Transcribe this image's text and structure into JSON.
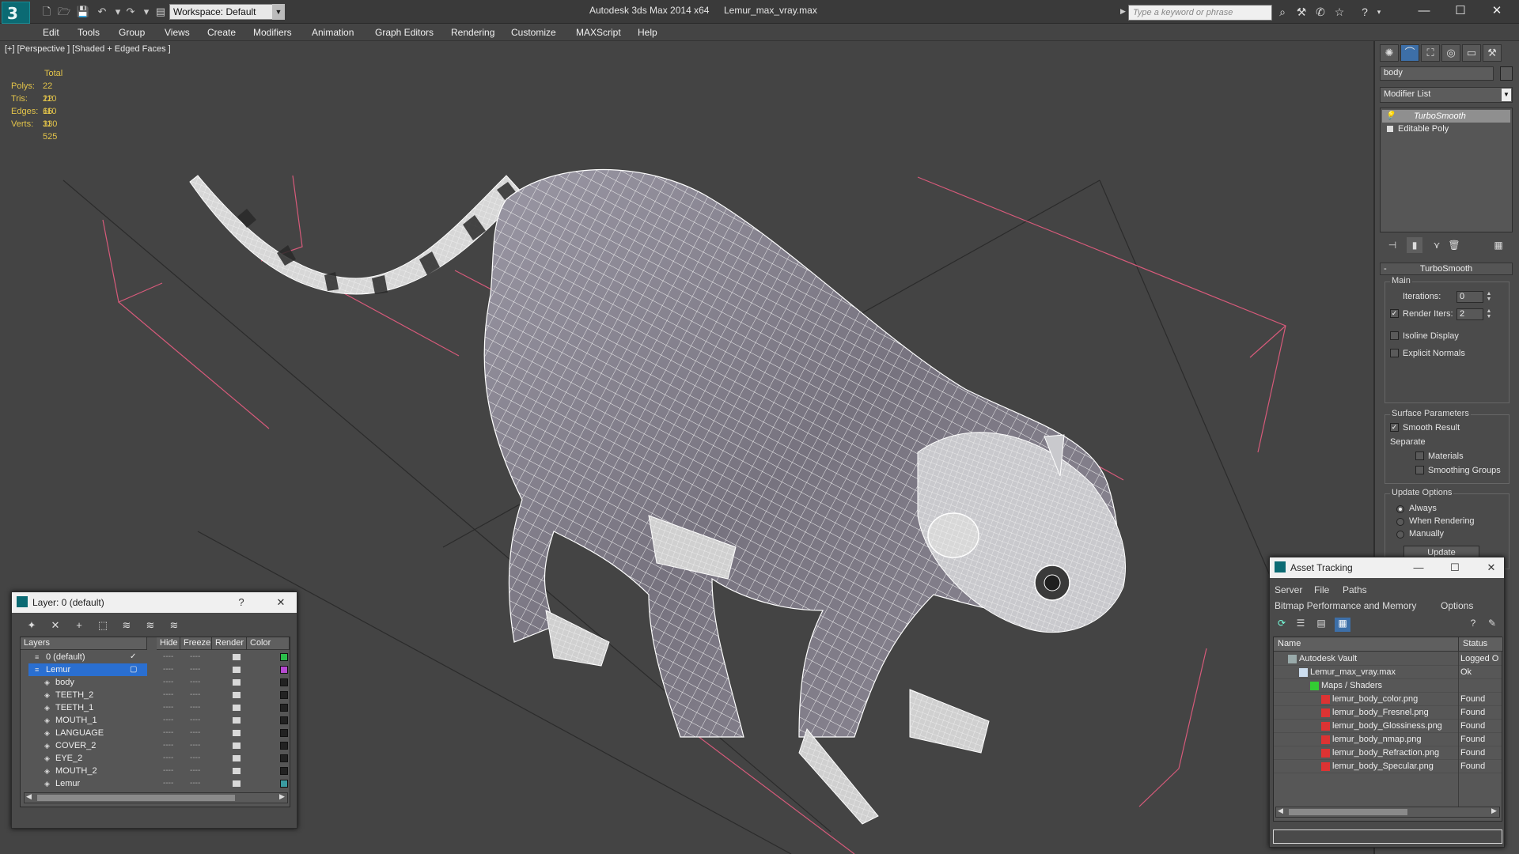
{
  "titlebar": {
    "logo": "3",
    "workspace": "Workspace: Default",
    "app_title": "Autodesk 3ds Max 2014 x64",
    "file_title": "Lemur_max_vray.max",
    "search_placeholder": "Type a keyword or phrase",
    "window_buttons": [
      "—",
      "☐",
      "✕"
    ]
  },
  "menu": [
    "Edit",
    "Tools",
    "Group",
    "Views",
    "Create",
    "Modifiers",
    "Animation",
    "Graph Editors",
    "Rendering",
    "Customize",
    "MAXScript",
    "Help"
  ],
  "viewport": {
    "label": "[+] [Perspective ] [Shaded + Edged Faces ]",
    "stats_header": "Total",
    "stats": [
      {
        "key": "Polys:",
        "value": "22 110"
      },
      {
        "key": "Tris:",
        "value": "22 110"
      },
      {
        "key": "Edges:",
        "value": "66 330"
      },
      {
        "key": "Verts:",
        "value": "11 525"
      }
    ]
  },
  "command_panel": {
    "object_name": "body",
    "modifier_list": "Modifier List",
    "stack": [
      {
        "label": "TurboSmooth",
        "selected": true
      },
      {
        "label": "Editable Poly",
        "selected": false
      }
    ],
    "rollout_title": "TurboSmooth",
    "main_group": "Main",
    "iterations_label": "Iterations:",
    "iterations_value": "0",
    "render_iters_label": "Render Iters:",
    "render_iters_value": "2",
    "render_iters_checked": true,
    "isoline_label": "Isoline Display",
    "explicit_normals_label": "Explicit Normals",
    "surface_group": "Surface Parameters",
    "smooth_result_label": "Smooth Result",
    "separate_label": "Separate",
    "materials_label": "Materials",
    "smoothing_groups_label": "Smoothing Groups",
    "update_group": "Update Options",
    "always_label": "Always",
    "when_rendering_label": "When Rendering",
    "manually_label": "Manually",
    "update_button": "Update"
  },
  "layer_dialog": {
    "title": "Layer: 0 (default)",
    "help": "?",
    "close": "✕",
    "columns": [
      "Layers",
      "Hide",
      "Freeze",
      "Render",
      "Color"
    ],
    "rows": [
      {
        "name": "0 (default)",
        "indent": 1,
        "color": "#2bbd4a",
        "active": true
      },
      {
        "name": "Lemur",
        "indent": 1,
        "color": "#b64ad0",
        "selected": true
      },
      {
        "name": "body",
        "indent": 2,
        "color": "#222222"
      },
      {
        "name": "TEETH_2",
        "indent": 2,
        "color": "#222222"
      },
      {
        "name": "TEETH_1",
        "indent": 2,
        "color": "#222222"
      },
      {
        "name": "MOUTH_1",
        "indent": 2,
        "color": "#222222"
      },
      {
        "name": "LANGUAGE",
        "indent": 2,
        "color": "#222222"
      },
      {
        "name": "COVER_2",
        "indent": 2,
        "color": "#222222"
      },
      {
        "name": "EYE_2",
        "indent": 2,
        "color": "#222222"
      },
      {
        "name": "MOUTH_2",
        "indent": 2,
        "color": "#222222"
      },
      {
        "name": "Lemur",
        "indent": 2,
        "color": "#3a9aa0"
      }
    ]
  },
  "asset_dialog": {
    "title": "Asset Tracking",
    "menu_row1": [
      "Server",
      "File",
      "Paths"
    ],
    "menu_row2": [
      "Bitmap Performance and Memory",
      "Options"
    ],
    "columns": [
      "Name",
      "Status"
    ],
    "rows": [
      {
        "name": "Autodesk Vault",
        "status": "Logged O",
        "indent": 0,
        "icon": "vault"
      },
      {
        "name": "Lemur_max_vray.max",
        "status": "Ok",
        "indent": 1,
        "icon": "max"
      },
      {
        "name": "Maps / Shaders",
        "status": "",
        "indent": 2,
        "icon": "maps"
      },
      {
        "name": "lemur_body_color.png",
        "status": "Found",
        "indent": 3,
        "icon": "png"
      },
      {
        "name": "lemur_body_Fresnel.png",
        "status": "Found",
        "indent": 3,
        "icon": "png"
      },
      {
        "name": "lemur_body_Glossiness.png",
        "status": "Found",
        "indent": 3,
        "icon": "png"
      },
      {
        "name": "lemur_body_nmap.png",
        "status": "Found",
        "indent": 3,
        "icon": "png"
      },
      {
        "name": "lemur_body_Refraction.png",
        "status": "Found",
        "indent": 3,
        "icon": "png"
      },
      {
        "name": "lemur_body_Specular.png",
        "status": "Found",
        "indent": 3,
        "icon": "png"
      }
    ]
  },
  "colors": {
    "accent_teal": "#0b6a73",
    "stats_yellow": "#e3c44a",
    "selection_blue": "#2a6fd1",
    "gizmo_pink": "#d65a7a"
  }
}
